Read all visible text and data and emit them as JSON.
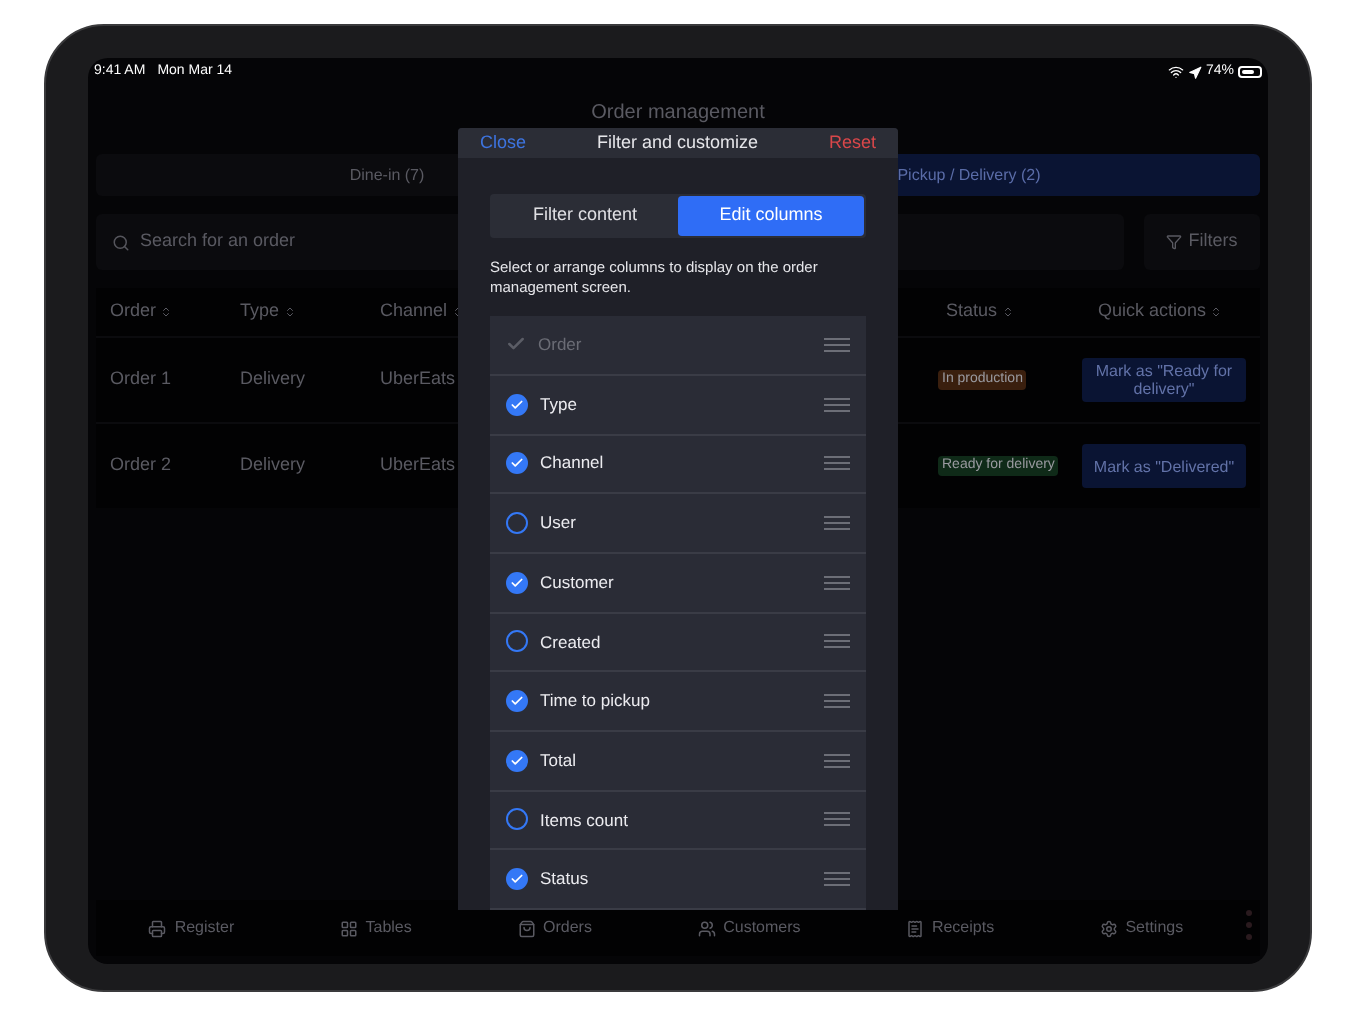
{
  "status_bar": {
    "time": "9:41 AM",
    "date": "Mon Mar 14",
    "battery": "74%"
  },
  "screen": {
    "title": "Order management"
  },
  "tabs": [
    {
      "label": "Dine-in (7)",
      "selected": false
    },
    {
      "label": "Pickup / Delivery (2)",
      "selected": true
    }
  ],
  "search": {
    "placeholder": "Search for an order"
  },
  "filters_button": "Filters",
  "table": {
    "columns": [
      "Order",
      "Type",
      "Channel",
      "Status",
      "Quick actions"
    ],
    "rows": [
      {
        "order": "Order 1",
        "type": "Delivery",
        "channel": "UberEats",
        "status": {
          "label": "In production",
          "color": "#3a1f0e"
        },
        "action": "Mark as \"Ready for delivery\""
      },
      {
        "order": "Order 2",
        "type": "Delivery",
        "channel": "UberEats",
        "status": {
          "label": "Ready for delivery",
          "color": "#0f2a18"
        },
        "action": "Mark as \"Delivered\""
      }
    ]
  },
  "tab_bar": [
    {
      "kind": "register",
      "label": "Register"
    },
    {
      "kind": "tables",
      "label": "Tables"
    },
    {
      "kind": "orders",
      "label": "Orders"
    },
    {
      "kind": "customers",
      "label": "Customers"
    },
    {
      "kind": "receipts",
      "label": "Receipts"
    },
    {
      "kind": "settings",
      "label": "Settings"
    }
  ],
  "modal": {
    "close": "Close",
    "title": "Filter and customize",
    "reset": "Reset",
    "segments": [
      {
        "label": "Filter content",
        "selected": false
      },
      {
        "label": "Edit columns",
        "selected": true
      }
    ],
    "description": "Select or arrange columns to display on the order management screen.",
    "columns": [
      {
        "label": "Order",
        "checked": true,
        "disabled": true
      },
      {
        "label": "Type",
        "checked": true,
        "disabled": false
      },
      {
        "label": "Channel",
        "checked": true,
        "disabled": false
      },
      {
        "label": "User",
        "checked": false,
        "disabled": false
      },
      {
        "label": "Customer",
        "checked": true,
        "disabled": false
      },
      {
        "label": "Created",
        "checked": false,
        "disabled": false
      },
      {
        "label": "Time to pickup",
        "checked": true,
        "disabled": false
      },
      {
        "label": "Total",
        "checked": true,
        "disabled": false
      },
      {
        "label": "Items count",
        "checked": false,
        "disabled": false
      },
      {
        "label": "Status",
        "checked": true,
        "disabled": false
      }
    ]
  }
}
